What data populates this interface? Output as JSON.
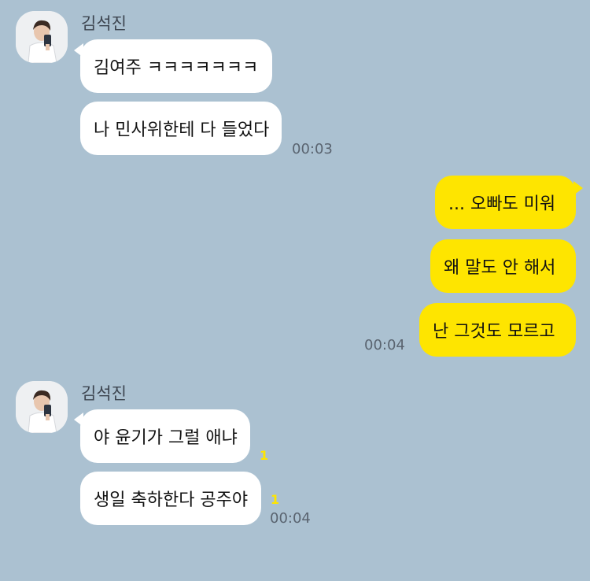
{
  "chat": {
    "group1": {
      "sender": "김석진",
      "messages": [
        "김여주 ㅋㅋㅋㅋㅋㅋㅋ",
        "나 민사위한테 다 들었다"
      ],
      "time": "00:03"
    },
    "group2": {
      "messages": [
        "... 오빠도 미워",
        "왜 말도 안 해서",
        "난 그것도 모르고"
      ],
      "time": "00:04"
    },
    "group3": {
      "sender": "김석진",
      "messages": [
        "야 윤기가 그럴 애냐",
        "생일 축하한다 공주야"
      ],
      "unread": [
        "1",
        "1"
      ],
      "time": "00:04"
    }
  },
  "colors": {
    "background": "#abc1d1",
    "my_bubble": "#fee500",
    "other_bubble": "#ffffff"
  }
}
